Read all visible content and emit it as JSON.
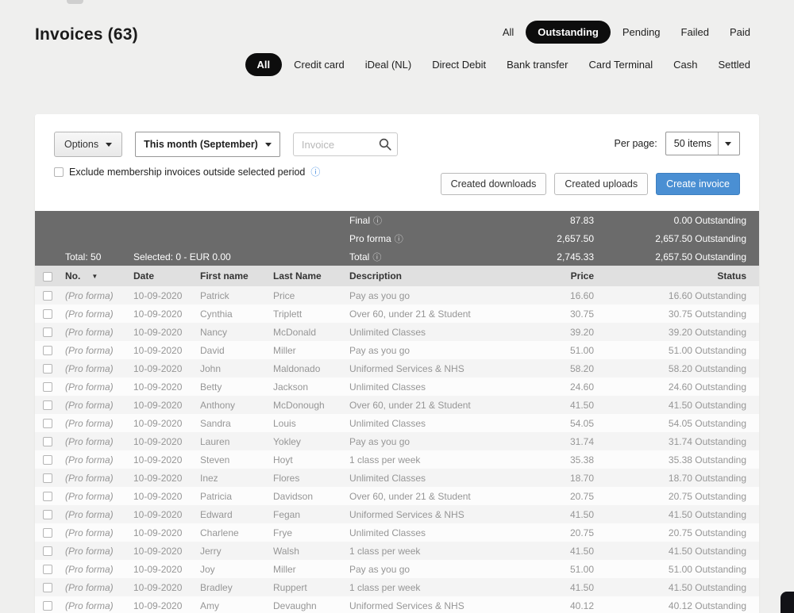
{
  "page": {
    "title": "Invoices (63)"
  },
  "colors": {
    "accent_blue": "#4a8fd3",
    "pill_active": "#0d0d0d",
    "summary_bg": "#6b6b6b"
  },
  "status_filters": [
    {
      "label": "All",
      "active": false
    },
    {
      "label": "Outstanding",
      "active": true
    },
    {
      "label": "Pending",
      "active": false
    },
    {
      "label": "Failed",
      "active": false
    },
    {
      "label": "Paid",
      "active": false
    }
  ],
  "payment_filters": [
    {
      "label": "All",
      "active": true
    },
    {
      "label": "Credit card",
      "active": false
    },
    {
      "label": "iDeal (NL)",
      "active": false
    },
    {
      "label": "Direct Debit",
      "active": false
    },
    {
      "label": "Bank transfer",
      "active": false
    },
    {
      "label": "Card Terminal",
      "active": false
    },
    {
      "label": "Cash",
      "active": false
    },
    {
      "label": "Settled",
      "active": false
    }
  ],
  "toolbar": {
    "options_label": "Options",
    "period_value": "This month (September)",
    "search_placeholder": "Invoice",
    "exclude_label": "Exclude membership invoices outside selected period",
    "info_icon": "ⓘ",
    "per_page_label": "Per page:",
    "per_page_value": "50 items",
    "created_downloads_label": "Created downloads",
    "created_uploads_label": "Created uploads",
    "create_invoice_label": "Create invoice"
  },
  "summary": {
    "rows": [
      {
        "left1": "",
        "left2": "",
        "label": "Final",
        "price": "87.83",
        "status": "0.00 Outstanding"
      },
      {
        "left1": "",
        "left2": "",
        "label": "Pro forma",
        "price": "2,657.50",
        "status": "2,657.50 Outstanding"
      },
      {
        "left1": "Total: 50",
        "left2": "Selected: 0 - EUR 0.00",
        "label": "Total",
        "price": "2,745.33",
        "status": "2,657.50 Outstanding"
      }
    ]
  },
  "table": {
    "headers": {
      "no": "No.",
      "date": "Date",
      "first": "First name",
      "last": "Last Name",
      "desc": "Description",
      "price": "Price",
      "status": "Status"
    },
    "sort_icon": "▼",
    "rows": [
      {
        "no": "(Pro forma)",
        "date": "10-09-2020",
        "first": "Patrick",
        "last": "Price",
        "desc": "Pay as you go",
        "price": "16.60",
        "status": "16.60 Outstanding"
      },
      {
        "no": "(Pro forma)",
        "date": "10-09-2020",
        "first": "Cynthia",
        "last": "Triplett",
        "desc": "Over 60, under 21 & Student",
        "price": "30.75",
        "status": "30.75 Outstanding"
      },
      {
        "no": "(Pro forma)",
        "date": "10-09-2020",
        "first": "Nancy",
        "last": "McDonald",
        "desc": "Unlimited Classes",
        "price": "39.20",
        "status": "39.20 Outstanding"
      },
      {
        "no": "(Pro forma)",
        "date": "10-09-2020",
        "first": "David",
        "last": "Miller",
        "desc": "Pay as you go",
        "price": "51.00",
        "status": "51.00 Outstanding"
      },
      {
        "no": "(Pro forma)",
        "date": "10-09-2020",
        "first": "John",
        "last": "Maldonado",
        "desc": "Uniformed Services & NHS",
        "price": "58.20",
        "status": "58.20 Outstanding"
      },
      {
        "no": "(Pro forma)",
        "date": "10-09-2020",
        "first": "Betty",
        "last": "Jackson",
        "desc": "Unlimited Classes",
        "price": "24.60",
        "status": "24.60 Outstanding"
      },
      {
        "no": "(Pro forma)",
        "date": "10-09-2020",
        "first": "Anthony",
        "last": "McDonough",
        "desc": "Over 60, under 21 & Student",
        "price": "41.50",
        "status": "41.50 Outstanding"
      },
      {
        "no": "(Pro forma)",
        "date": "10-09-2020",
        "first": "Sandra",
        "last": "Louis",
        "desc": "Unlimited Classes",
        "price": "54.05",
        "status": "54.05 Outstanding"
      },
      {
        "no": "(Pro forma)",
        "date": "10-09-2020",
        "first": "Lauren",
        "last": "Yokley",
        "desc": "Pay as you go",
        "price": "31.74",
        "status": "31.74 Outstanding"
      },
      {
        "no": "(Pro forma)",
        "date": "10-09-2020",
        "first": "Steven",
        "last": "Hoyt",
        "desc": "1 class per week",
        "price": "35.38",
        "status": "35.38 Outstanding"
      },
      {
        "no": "(Pro forma)",
        "date": "10-09-2020",
        "first": "Inez",
        "last": "Flores",
        "desc": "Unlimited Classes",
        "price": "18.70",
        "status": "18.70 Outstanding"
      },
      {
        "no": "(Pro forma)",
        "date": "10-09-2020",
        "first": "Patricia",
        "last": "Davidson",
        "desc": "Over 60, under 21 & Student",
        "price": "20.75",
        "status": "20.75 Outstanding"
      },
      {
        "no": "(Pro forma)",
        "date": "10-09-2020",
        "first": "Edward",
        "last": "Fegan",
        "desc": "Uniformed Services & NHS",
        "price": "41.50",
        "status": "41.50 Outstanding"
      },
      {
        "no": "(Pro forma)",
        "date": "10-09-2020",
        "first": "Charlene",
        "last": "Frye",
        "desc": "Unlimited Classes",
        "price": "20.75",
        "status": "20.75 Outstanding"
      },
      {
        "no": "(Pro forma)",
        "date": "10-09-2020",
        "first": "Jerry",
        "last": "Walsh",
        "desc": "1 class per week",
        "price": "41.50",
        "status": "41.50 Outstanding"
      },
      {
        "no": "(Pro forma)",
        "date": "10-09-2020",
        "first": "Joy",
        "last": "Miller",
        "desc": "Pay as you go",
        "price": "51.00",
        "status": "51.00 Outstanding"
      },
      {
        "no": "(Pro forma)",
        "date": "10-09-2020",
        "first": "Bradley",
        "last": "Ruppert",
        "desc": "1 class per week",
        "price": "41.50",
        "status": "41.50 Outstanding"
      },
      {
        "no": "(Pro forma)",
        "date": "10-09-2020",
        "first": "Amy",
        "last": "Devaughn",
        "desc": "Uniformed Services & NHS",
        "price": "40.12",
        "status": "40.12 Outstanding"
      }
    ]
  }
}
